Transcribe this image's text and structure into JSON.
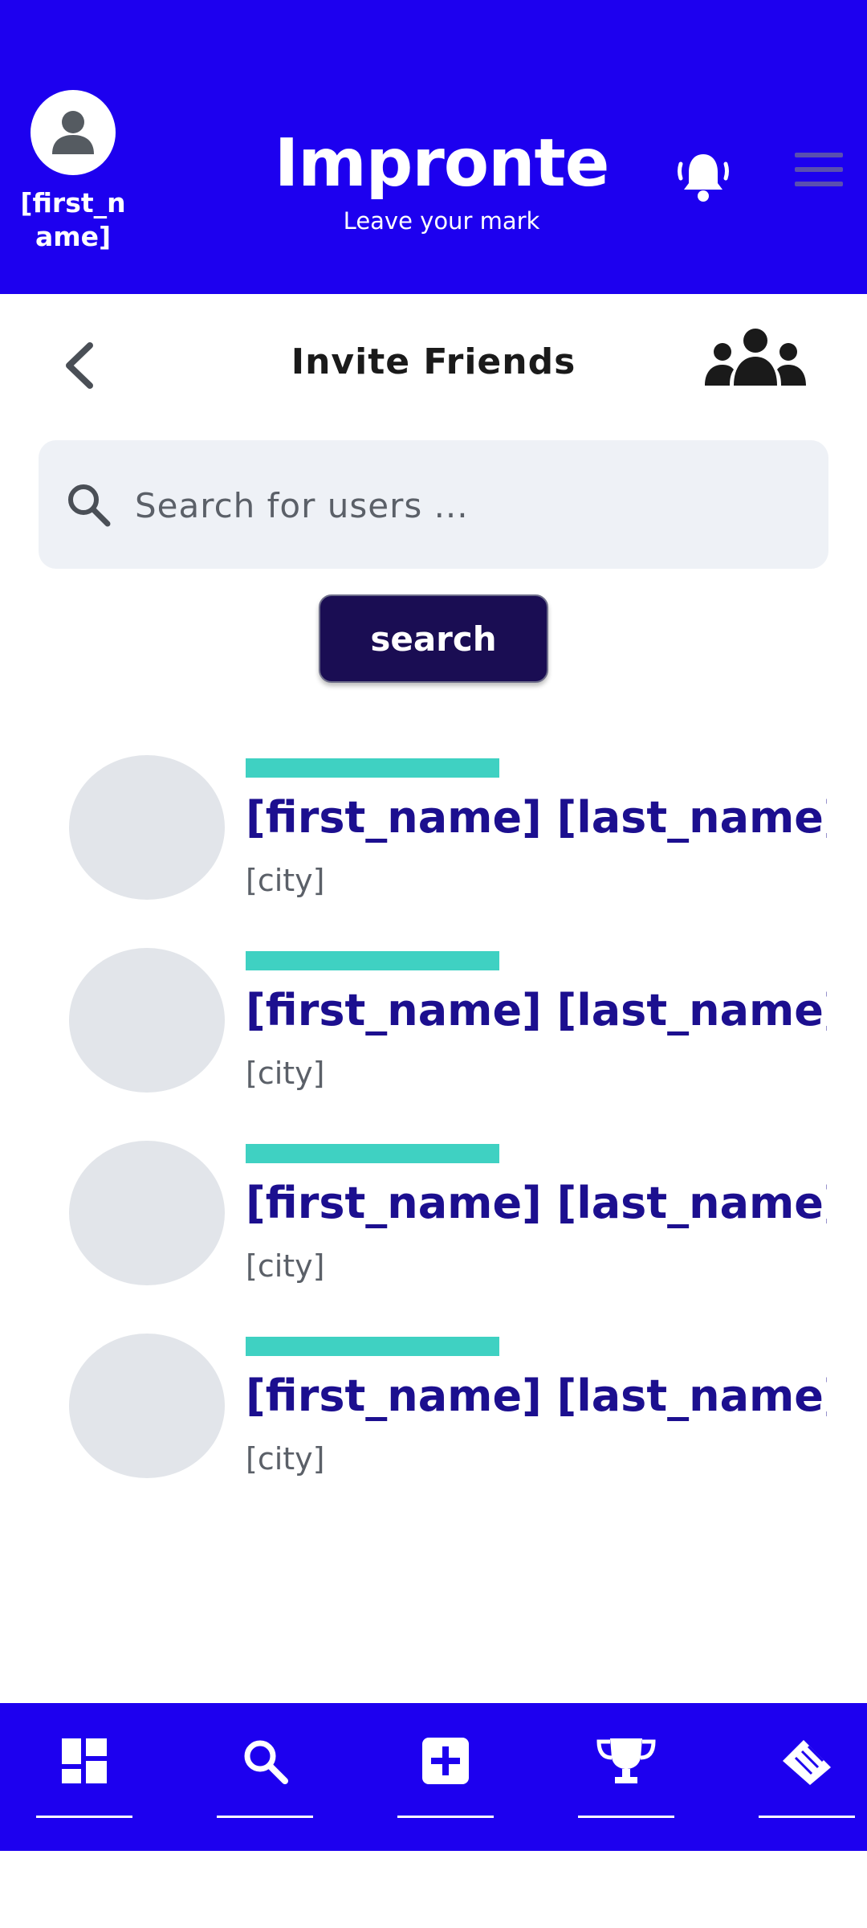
{
  "header": {
    "user_name": "[first_name]",
    "brand_title": "Impronte",
    "brand_subtitle": "Leave your mark"
  },
  "page": {
    "title": "Invite Friends"
  },
  "search": {
    "placeholder": "Search for users ...",
    "button_label": "search"
  },
  "results": [
    {
      "name": "[first_name] [last_name]",
      "city": "[city]"
    },
    {
      "name": "[first_name] [last_name]",
      "city": "[city]"
    },
    {
      "name": "[first_name] [last_name]",
      "city": "[city]"
    },
    {
      "name": "[first_name] [last_name]",
      "city": "[city]"
    }
  ],
  "bottom_nav": [
    {
      "icon": "dashboard-icon"
    },
    {
      "icon": "search-icon"
    },
    {
      "icon": "add-icon"
    },
    {
      "icon": "trophy-icon"
    },
    {
      "icon": "handshake-icon"
    }
  ],
  "colors": {
    "primary": "#1d00ef",
    "button_dark": "#1a0d53",
    "accent_teal": "#3fd1c2",
    "name_color": "#1c0f8f"
  }
}
